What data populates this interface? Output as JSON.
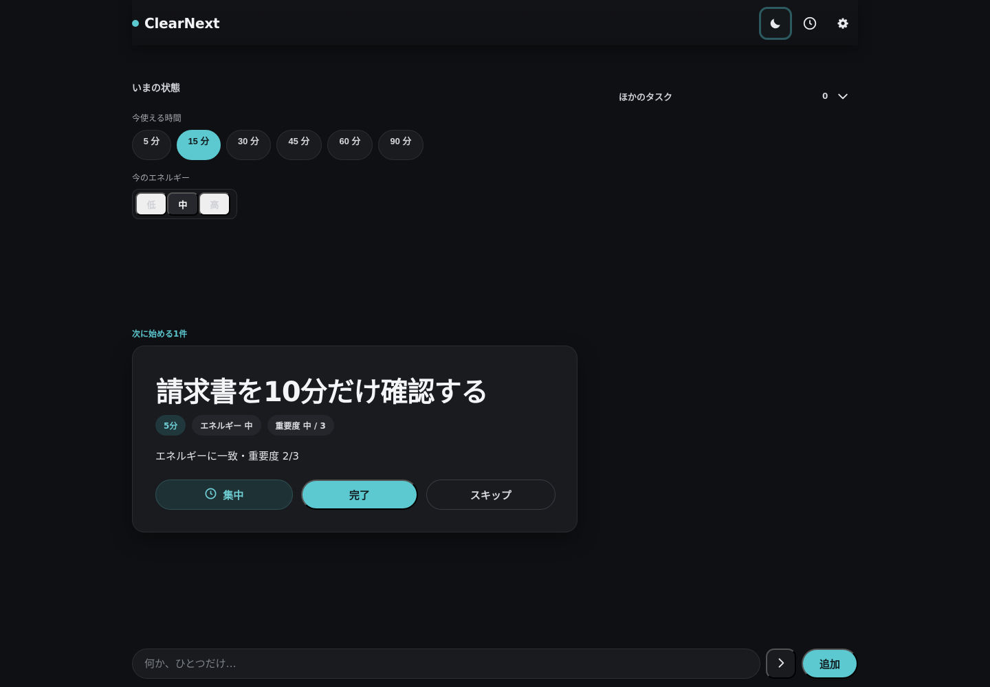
{
  "header": {
    "brand": "ClearNext",
    "icons": [
      "moon-icon",
      "clock-icon",
      "gear-icon"
    ]
  },
  "status": {
    "title": "いまの状態",
    "time_label": "今使える時間",
    "time_options": [
      "5 分",
      "15 分",
      "30 分",
      "45 分",
      "60 分",
      "90 分"
    ],
    "time_selected": "15 分",
    "energy_label": "今のエネルギー",
    "energy_options": [
      "低",
      "中",
      "高"
    ],
    "energy_selected": "中"
  },
  "other_tasks": {
    "title": "ほかのタスク",
    "count": "0"
  },
  "next": {
    "label": "次に始める1件",
    "title": "請求書を10分だけ確認する",
    "chips": [
      "5分",
      "エネルギー 中",
      "重要度 中 / 3"
    ],
    "reason": "エネルギーに一致・重要度 2/3",
    "focus_label": "集中",
    "done_label": "完了",
    "skip_label": "スキップ"
  },
  "composer": {
    "placeholder": "何か、ひとつだけ…",
    "add_label": "追加"
  },
  "colors": {
    "accent": "#5cc8d0",
    "background": "#0f1013",
    "card": "#1a1b1f"
  }
}
